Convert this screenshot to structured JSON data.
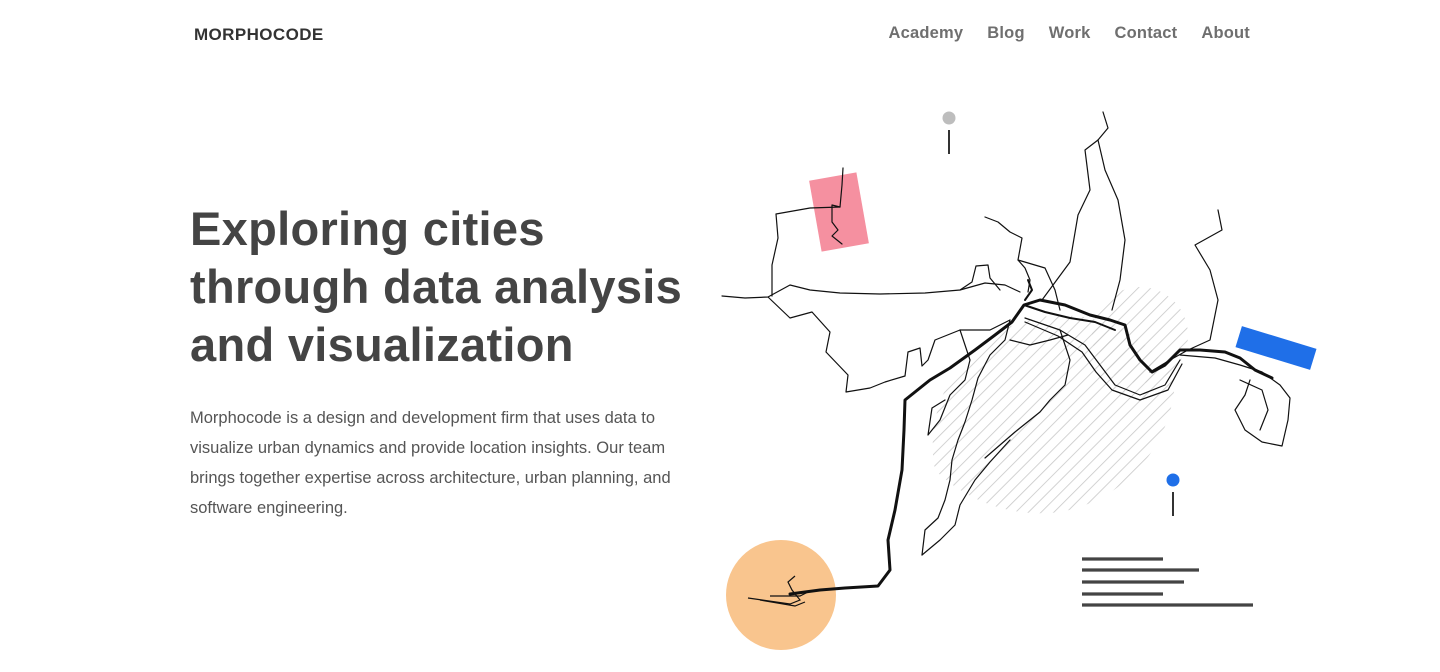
{
  "header": {
    "logo": "MORPHOCODE",
    "nav": [
      {
        "label": "Academy"
      },
      {
        "label": "Blog"
      },
      {
        "label": "Work"
      },
      {
        "label": "Contact"
      },
      {
        "label": "About"
      }
    ]
  },
  "hero": {
    "title": "Exploring cities through data analysis and visualization",
    "description": "Morphocode is a design and development firm that uses data to visualize urban dynamics and provide location insights. Our team brings together expertise across architecture, urban planning, and software engineering."
  },
  "colors": {
    "text_dark": "#444444",
    "nav_text": "#6f6f6f",
    "accent_pink": "#f590a0",
    "accent_blue": "#1f6fe8",
    "accent_orange": "#f9c58e",
    "hatch_gray": "#c8c8c8"
  }
}
